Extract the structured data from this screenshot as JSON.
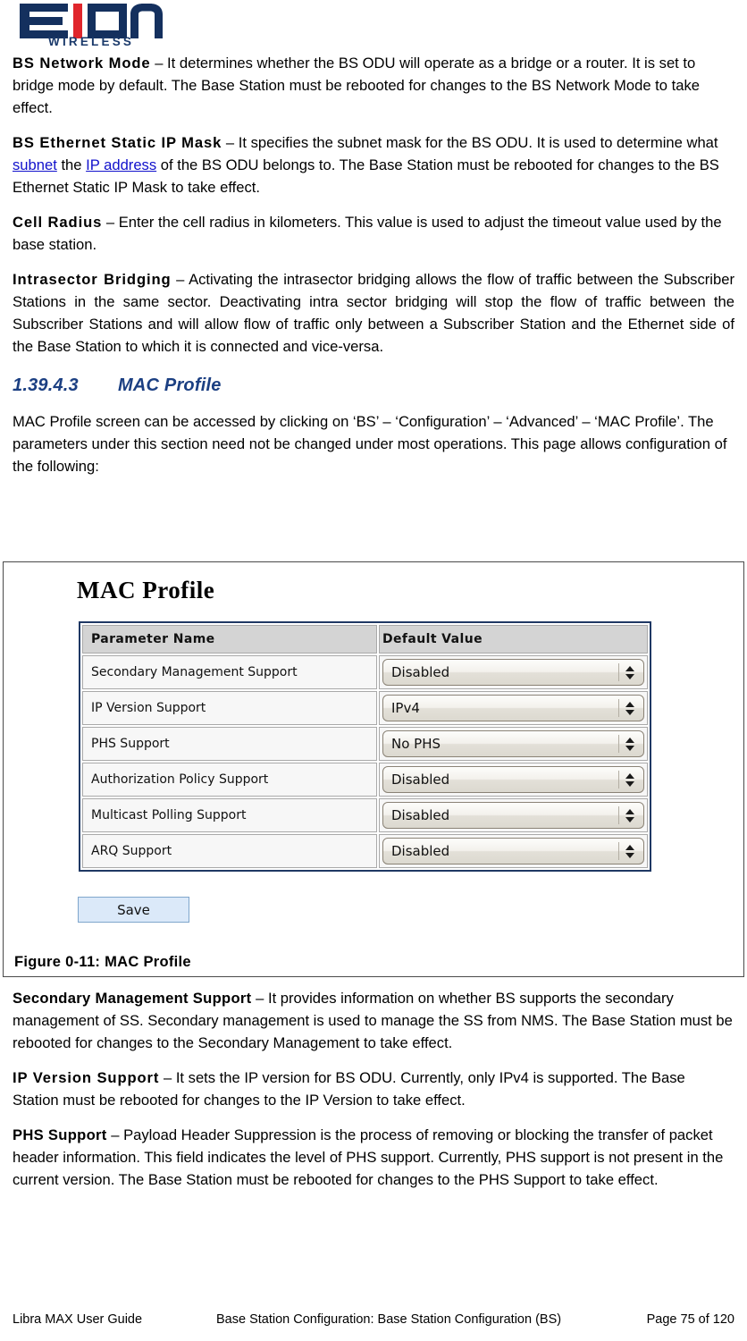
{
  "logo": {
    "name": "eion-wireless-logo",
    "wordmark": "EION",
    "tagline": "WIRELESS",
    "navy": "#14305e",
    "red": "#e0262c"
  },
  "body": {
    "paragraphs": [
      {
        "lead": "BS Network Mode",
        "dash": " – ",
        "text": "It determines whether the BS ODU will operate as a bridge or a router. It is set to bridge mode by default. The Base Station must be rebooted for changes to the BS Network Mode to take effect."
      },
      {
        "lead": "BS Ethernet Static IP Mask",
        "dash": " – ",
        "text_a": "It specifies the subnet mask for the BS ODU. It is used to determine what ",
        "link_1": "subnet",
        "text_b": " the ",
        "link_2": "IP address",
        "text_c": " of the BS ODU belongs to. The Base Station must be rebooted for changes to the BS Ethernet Static IP Mask to take effect."
      },
      {
        "lead": "Cell Radius",
        "dash": " – ",
        "text": "Enter the cell radius in kilometers. This value is used to adjust the timeout value used by the base station."
      },
      {
        "lead": "Intrasector Bridging",
        "dash": " – ",
        "text": "Activating the intrasector bridging allows the flow of traffic between the Subscriber Stations in the same sector. Deactivating intra sector bridging will stop the flow of traffic between the Subscriber Stations and will allow flow of traffic only between a Subscriber Station and the Ethernet side of the Base Station to which it is connected and vice-versa."
      }
    ]
  },
  "section": {
    "number": "1.39.4.3",
    "title": "MAC Profile",
    "intro": "MAC Profile screen can be accessed by clicking on ‘BS’ – ‘Configuration’ – ‘Advanced’ – ‘MAC Profile’.  The parameters under this section need not be changed under most operations. This page allows configuration of the following:"
  },
  "figure": {
    "screen_title": "MAC Profile",
    "caption": "Figure 0-11: MAC Profile",
    "save_label": "Save",
    "table": {
      "headers": [
        "Parameter Name",
        "Default Value"
      ],
      "rows": [
        {
          "name": "Secondary Management Support",
          "value": "Disabled"
        },
        {
          "name": "IP Version Support",
          "value": "IPv4"
        },
        {
          "name": "PHS Support",
          "value": "No PHS"
        },
        {
          "name": "Authorization Policy Support",
          "value": "Disabled"
        },
        {
          "name": "Multicast Polling Support",
          "value": "Disabled"
        },
        {
          "name": "ARQ Support",
          "value": "Disabled"
        }
      ]
    },
    "border_color": "#1f3864",
    "header_bg": "#d4d4d4"
  },
  "lower": {
    "paragraphs": [
      {
        "lead": "Secondary Management Support",
        "dash": " – ",
        "text": "It provides information on whether BS supports the secondary management of SS. Secondary management is used to manage the SS from NMS. The Base Station must be rebooted for changes to the Secondary Management to take effect."
      },
      {
        "lead": "IP Version Support",
        "dash": " – ",
        "text": "It sets the IP version for BS ODU. Currently, only IPv4 is supported. The Base Station must be rebooted for changes to the IP Version to take effect."
      },
      {
        "lead": "PHS Support",
        "dash": " – ",
        "text": "Payload Header Suppression is the process of removing or blocking the transfer of packet header information. This field indicates the level of PHS support. Currently, PHS support is not present in the current version. The Base Station must be rebooted for changes to the PHS Support to take effect."
      }
    ]
  },
  "footer": {
    "left": "Libra MAX User Guide",
    "middle": "Base Station Configuration: Base Station Configuration (BS)",
    "right": "Page 75 of 120"
  }
}
